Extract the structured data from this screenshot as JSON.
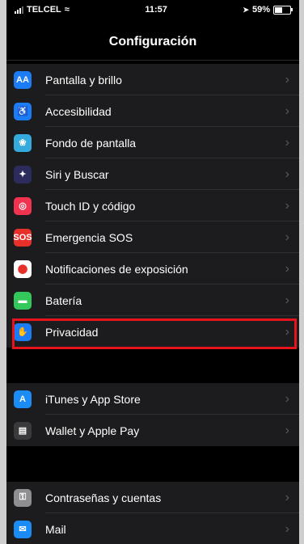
{
  "status": {
    "carrier": "TELCEL",
    "time": "11:57",
    "battery": "59%",
    "battery_level": 0.59
  },
  "nav": {
    "title": "Configuración"
  },
  "groups": [
    {
      "items": [
        {
          "label": "Pantalla y brillo",
          "icon": "display-brightness-icon",
          "color": "#1b7cf5",
          "glyph": "AA"
        },
        {
          "label": "Accesibilidad",
          "icon": "accessibility-icon",
          "color": "#1b7cf5",
          "glyph": "♿"
        },
        {
          "label": "Fondo de pantalla",
          "icon": "wallpaper-icon",
          "color": "#35aadc",
          "glyph": "❀"
        },
        {
          "label": "Siri y Buscar",
          "icon": "siri-icon",
          "color": "#2b2b5e",
          "glyph": "✦"
        },
        {
          "label": "Touch ID y código",
          "icon": "fingerprint-icon",
          "color": "#f0344f",
          "glyph": "◎"
        },
        {
          "label": "Emergencia SOS",
          "icon": "sos-icon",
          "color": "#e8302b",
          "glyph": "SOS"
        },
        {
          "label": "Notificaciones de exposición",
          "icon": "exposure-notification-icon",
          "color": "#ffffff",
          "glyph": "⬤"
        },
        {
          "label": "Batería",
          "icon": "battery-icon",
          "color": "#34c759",
          "glyph": "▬"
        },
        {
          "label": "Privacidad",
          "icon": "privacy-hand-icon",
          "color": "#1b7cf5",
          "glyph": "✋"
        }
      ]
    },
    {
      "items": [
        {
          "label": "iTunes y App Store",
          "icon": "app-store-icon",
          "color": "#1b8cf5",
          "glyph": "A"
        },
        {
          "label": "Wallet y Apple Pay",
          "icon": "wallet-icon",
          "color": "#3a3a3c",
          "glyph": "▤"
        }
      ]
    },
    {
      "items": [
        {
          "label": "Contraseñas y cuentas",
          "icon": "key-icon",
          "color": "#8e8e93",
          "glyph": "⚿"
        },
        {
          "label": "Mail",
          "icon": "mail-icon",
          "color": "#1b8cf5",
          "glyph": "✉"
        }
      ]
    }
  ],
  "highlight_color": "#e8141b"
}
